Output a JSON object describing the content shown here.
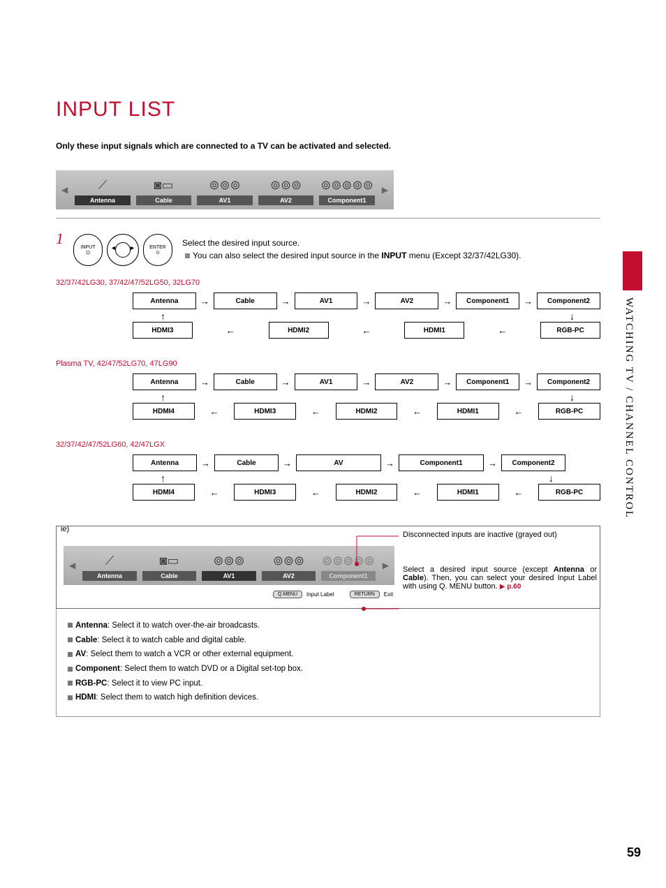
{
  "header": {
    "title": "INPUT LIST",
    "intro": "Only these input signals which are connected to a TV can be activated and selected.",
    "side_label": "WATCHING TV / CHANNEL CONTROL",
    "page_number": "59"
  },
  "input_bar": {
    "items": [
      "Antenna",
      "Cable",
      "AV1",
      "AV2",
      "Component1"
    ]
  },
  "step": {
    "num": "1",
    "btn_input": "INPUT",
    "btn_enter": "ENTER",
    "line1": "Select the desired input source.",
    "note_prefix": "You can also select the desired input source in the ",
    "note_bold": "INPUT",
    "note_suffix": " menu (Except 32/37/42LG30)."
  },
  "models": {
    "g1_title": "32/37/42LG30, 37/42/47/52LG50, 32LG70",
    "g1_top": [
      "Antenna",
      "Cable",
      "AV1",
      "AV2",
      "Component1",
      "Component2"
    ],
    "g1_bot": [
      "HDMI3",
      "HDMI2",
      "HDMI1",
      "RGB-PC"
    ],
    "g2_title": "Plasma TV, 42/47/52LG70, 47LG90",
    "g2_top": [
      "Antenna",
      "Cable",
      "AV1",
      "AV2",
      "Component1",
      "Component2"
    ],
    "g2_bot": [
      "HDMI4",
      "HDMI3",
      "HDMI2",
      "HDMI1",
      "RGB-PC"
    ],
    "g3_title": "32/37/42/47/52LG60, 42/47LGX",
    "g3_top": [
      "Antenna",
      "Cable",
      "AV",
      "Component1",
      "Component2"
    ],
    "g3_bot": [
      "HDMI4",
      "HDMI3",
      "HDMI2",
      "HDMI1",
      "RGB-PC"
    ]
  },
  "ie": {
    "label": "ie)",
    "items": [
      "Antenna",
      "Cable",
      "AV1",
      "AV2",
      "Component1"
    ],
    "inactive_index": 4,
    "callout_top": "Disconnected inputs are inactive (grayed out)",
    "callout_right_1": "Select a desired input source (except ",
    "callout_right_bold1": "Antenna",
    "callout_right_mid": " or ",
    "callout_right_bold2": "Cable",
    "callout_right_2": "). Then, you can select your desired Input Label with using Q. MENU button.",
    "page_ref": "p.60",
    "btn_qmenu": "Q.MENU",
    "btn_qmenu_label": "Input Label",
    "btn_return": "RETURN",
    "btn_return_label": "Exit"
  },
  "descriptions": {
    "antenna_b": "Antenna",
    "antenna": ": Select it to watch over-the-air broadcasts.",
    "cable_b": "Cable",
    "cable": ": Select it to watch cable and digital cable.",
    "av_b": "AV",
    "av": ": Select them to watch a VCR or other external equipment.",
    "component_b": "Component",
    "component": ": Select them to watch DVD or a Digital set-top box.",
    "rgb_b": "RGB-PC",
    "rgb": ": Select it to view PC input.",
    "hdmi_b": "HDMI",
    "hdmi": ": Select them to watch high definition devices."
  }
}
